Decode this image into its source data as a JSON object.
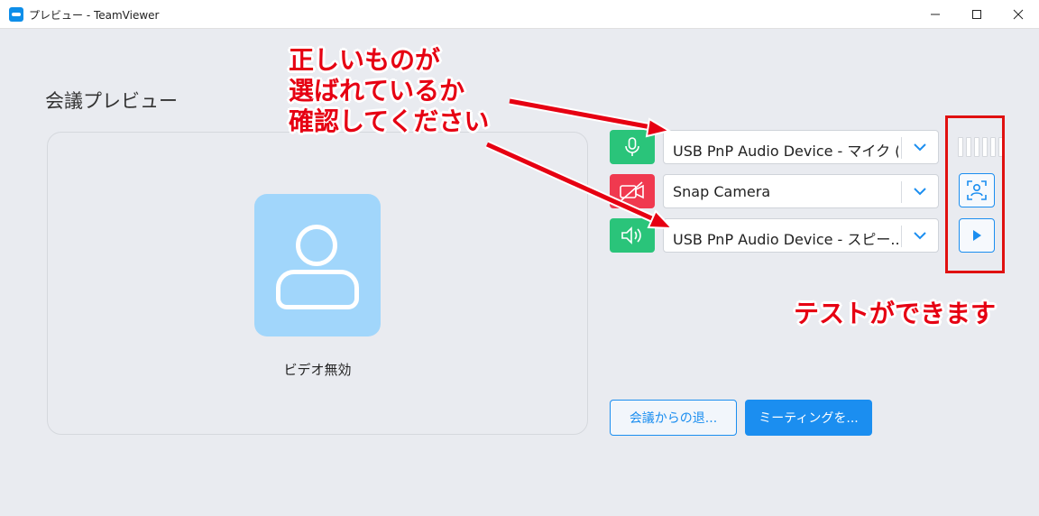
{
  "window": {
    "title": "プレビュー - TeamViewer"
  },
  "page": {
    "heading": "会議プレビュー"
  },
  "video_panel": {
    "status_label": "ビデオ無効"
  },
  "devices": {
    "microphone": {
      "value": "USB PnP Audio Device - マイク (...",
      "icon": "microphone-icon",
      "color": "#2ac47a"
    },
    "camera": {
      "value": "Snap Camera",
      "icon": "camera-off-icon",
      "color": "#f0394f"
    },
    "speaker": {
      "value": "USB PnP Audio Device - スピー...",
      "icon": "speaker-icon",
      "color": "#2ac47a"
    }
  },
  "buttons": {
    "leave": "会議からの退...",
    "join": "ミーティングを..."
  },
  "annotations": {
    "check_note_line1": "正しいものが",
    "check_note_line2": "選ばれているか",
    "check_note_line3": "確認してください",
    "test_note": "テストができます"
  },
  "colors": {
    "accent": "#1b8ef0",
    "annotation_red": "#e60012"
  }
}
